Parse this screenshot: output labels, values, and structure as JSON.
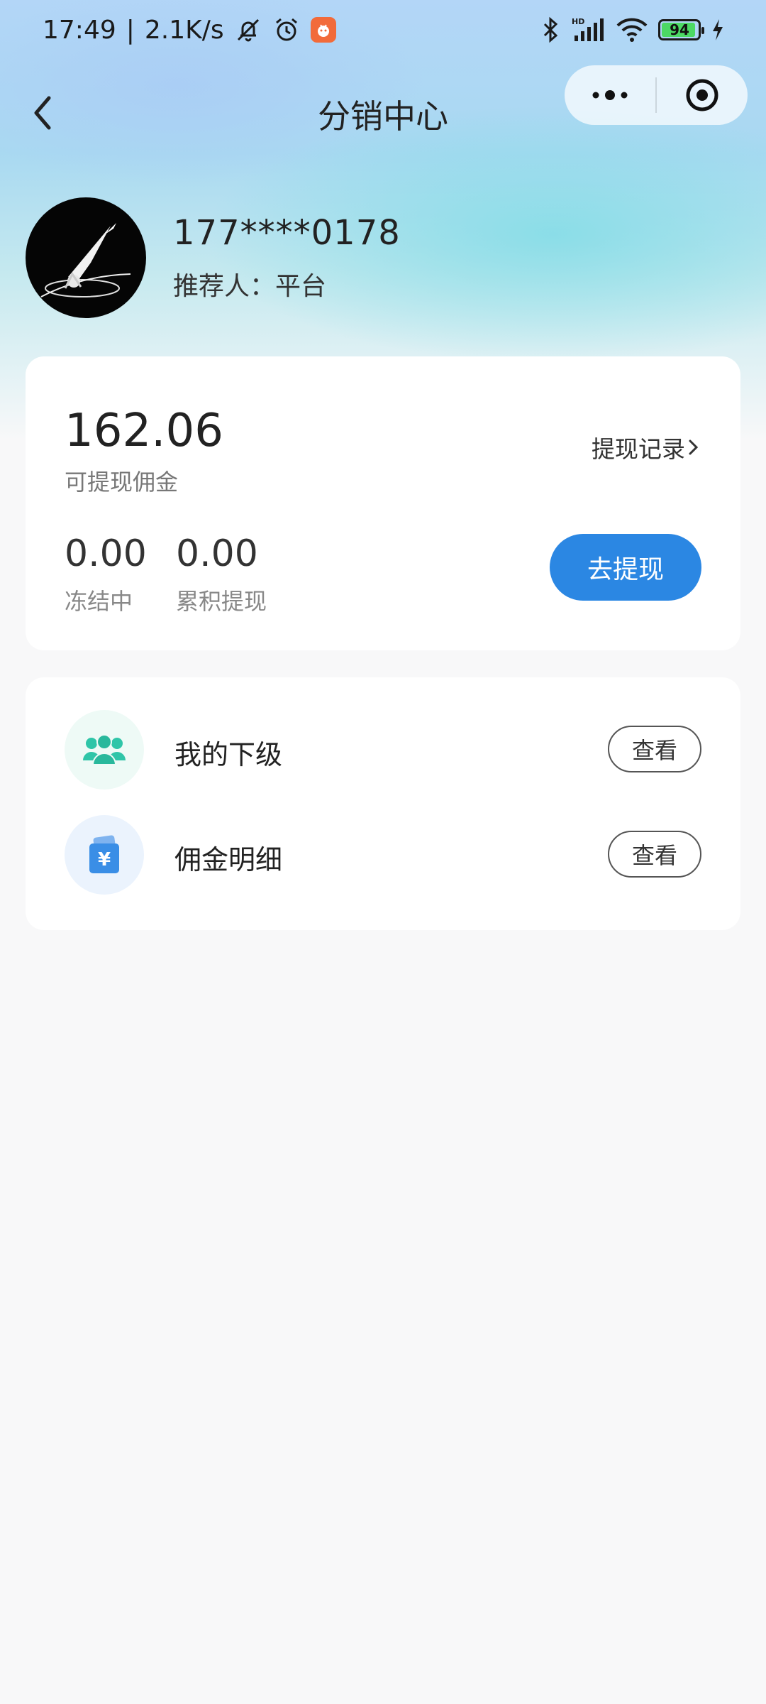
{
  "status_bar": {
    "time": "17:49",
    "separator": "|",
    "network_speed": "2.1K/s",
    "battery_level": "94",
    "battery_fraction": 0.94,
    "icons": [
      "mute-icon",
      "alarm-icon",
      "app-notification-icon",
      "bluetooth-icon",
      "hd-signal-icon",
      "wifi-icon",
      "battery-icon",
      "charging-icon"
    ]
  },
  "nav": {
    "title": "分销中心",
    "back_icon": "chevron-left-icon",
    "capsule_icons": [
      "more-icon",
      "close-target-icon"
    ]
  },
  "profile": {
    "phone": "177****0178",
    "referrer_label": "推荐人：",
    "referrer_value": "平台"
  },
  "commission": {
    "available_amount": "162.06",
    "available_label": "可提现佣金",
    "records_link": "提现记录",
    "frozen_amount": "0.00",
    "frozen_label": "冻结中",
    "total_withdrawn_amount": "0.00",
    "total_withdrawn_label": "累积提现",
    "withdraw_button": "去提现"
  },
  "menu": {
    "items": [
      {
        "label": "我的下级",
        "button": "查看",
        "icon": "team-icon",
        "color": "#2fc5a8"
      },
      {
        "label": "佣金明细",
        "button": "查看",
        "icon": "wallet-yuan-icon",
        "color": "#3a8ee6"
      }
    ]
  },
  "colors": {
    "primary": "#2b87e3",
    "page_background": "#f8f8f9"
  }
}
